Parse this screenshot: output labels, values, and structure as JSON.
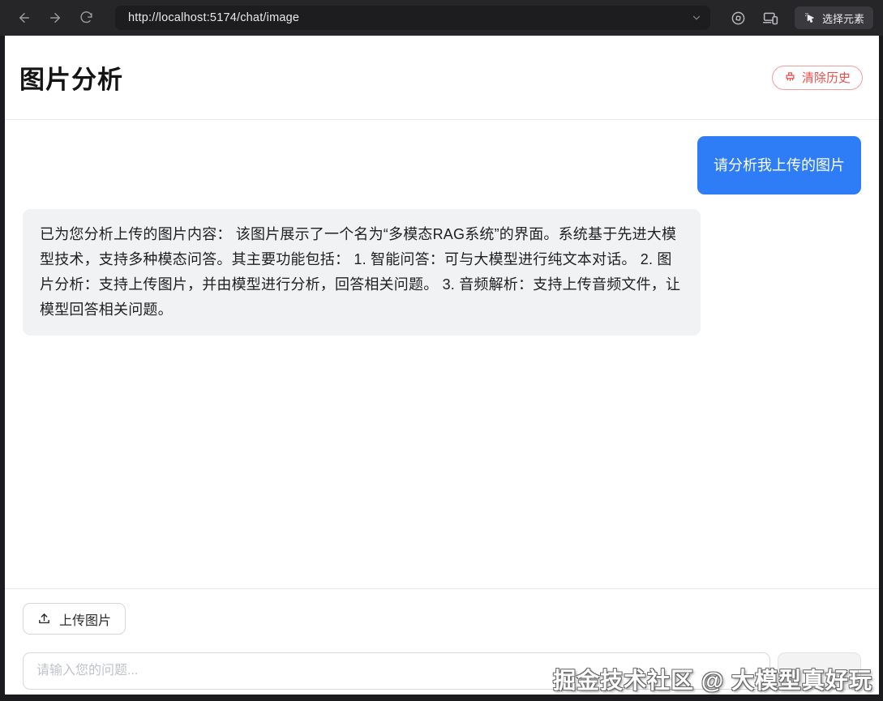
{
  "browser": {
    "url": "http://localhost:5174/chat/image",
    "select_element_label": "选择元素"
  },
  "header": {
    "title": "图片分析",
    "clear_history_label": "清除历史"
  },
  "chat": {
    "user_message": "请分析我上传的图片",
    "assistant_message": "已为您分析上传的图片内容： 该图片展示了一个名为“多模态RAG系统”的界面。系统基于先进大模型技术，支持多种模态问答。其主要功能包括： 1. 智能问答：可与大模型进行纯文本对话。 2. 图片分析：支持上传图片，并由模型进行分析，回答相关问题。 3. 音频解析：支持上传音频文件，让模型回答相关问题。"
  },
  "footer": {
    "upload_label": "上传图片",
    "input_placeholder": "请输入您的问题...",
    "input_value": ""
  },
  "watermark": "掘金技术社区 @ 大模型真好玩",
  "colors": {
    "accent_blue": "#2e7cf6",
    "danger_red": "#ef4d4d",
    "assistant_bubble_bg": "#f1f2f3",
    "toolbar_bg": "#262628"
  }
}
